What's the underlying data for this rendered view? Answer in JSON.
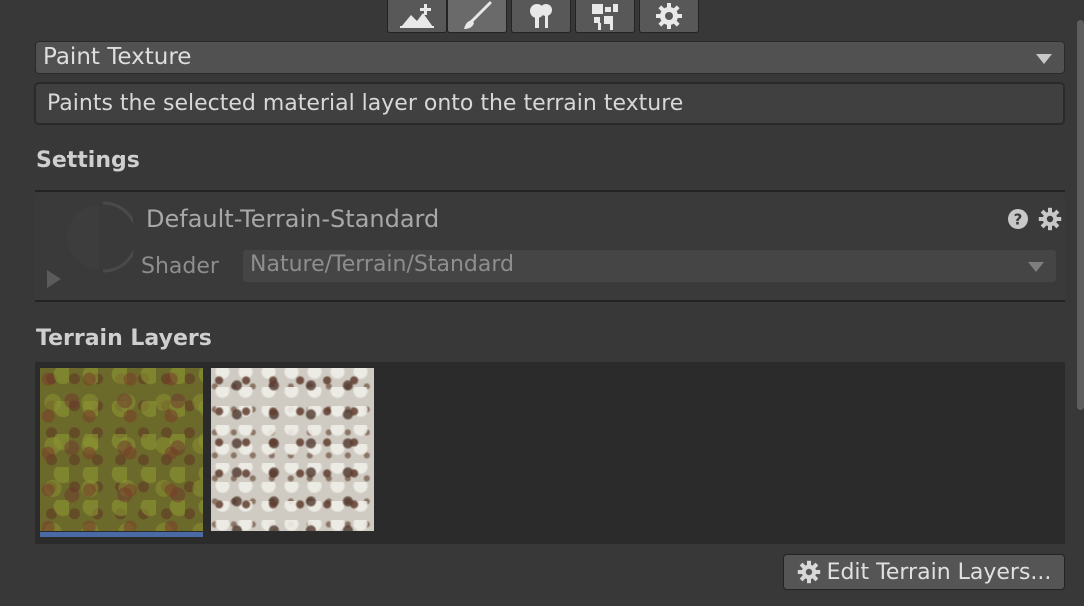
{
  "toolbar": {
    "tools": [
      {
        "name": "create-neighbor-terrain-icon"
      },
      {
        "name": "paint-brush-icon",
        "active": true
      },
      {
        "name": "paint-trees-icon"
      },
      {
        "name": "paint-details-icon"
      },
      {
        "name": "terrain-settings-icon"
      }
    ]
  },
  "tool_dropdown": {
    "value": "Paint Texture"
  },
  "help_text": "Paints the selected material layer onto the terrain texture",
  "settings": {
    "title": "Settings",
    "material": {
      "name": "Default-Terrain-Standard",
      "shader_label": "Shader",
      "shader_value": "Nature/Terrain/Standard"
    }
  },
  "terrain_layers": {
    "title": "Terrain Layers",
    "layers": [
      {
        "name": "grass-texture",
        "selected": true
      },
      {
        "name": "rock-texture",
        "selected": false
      }
    ],
    "edit_button_label": "Edit Terrain Layers..."
  },
  "colors": {
    "background": "#383838",
    "selection": "#4a6aa5"
  }
}
